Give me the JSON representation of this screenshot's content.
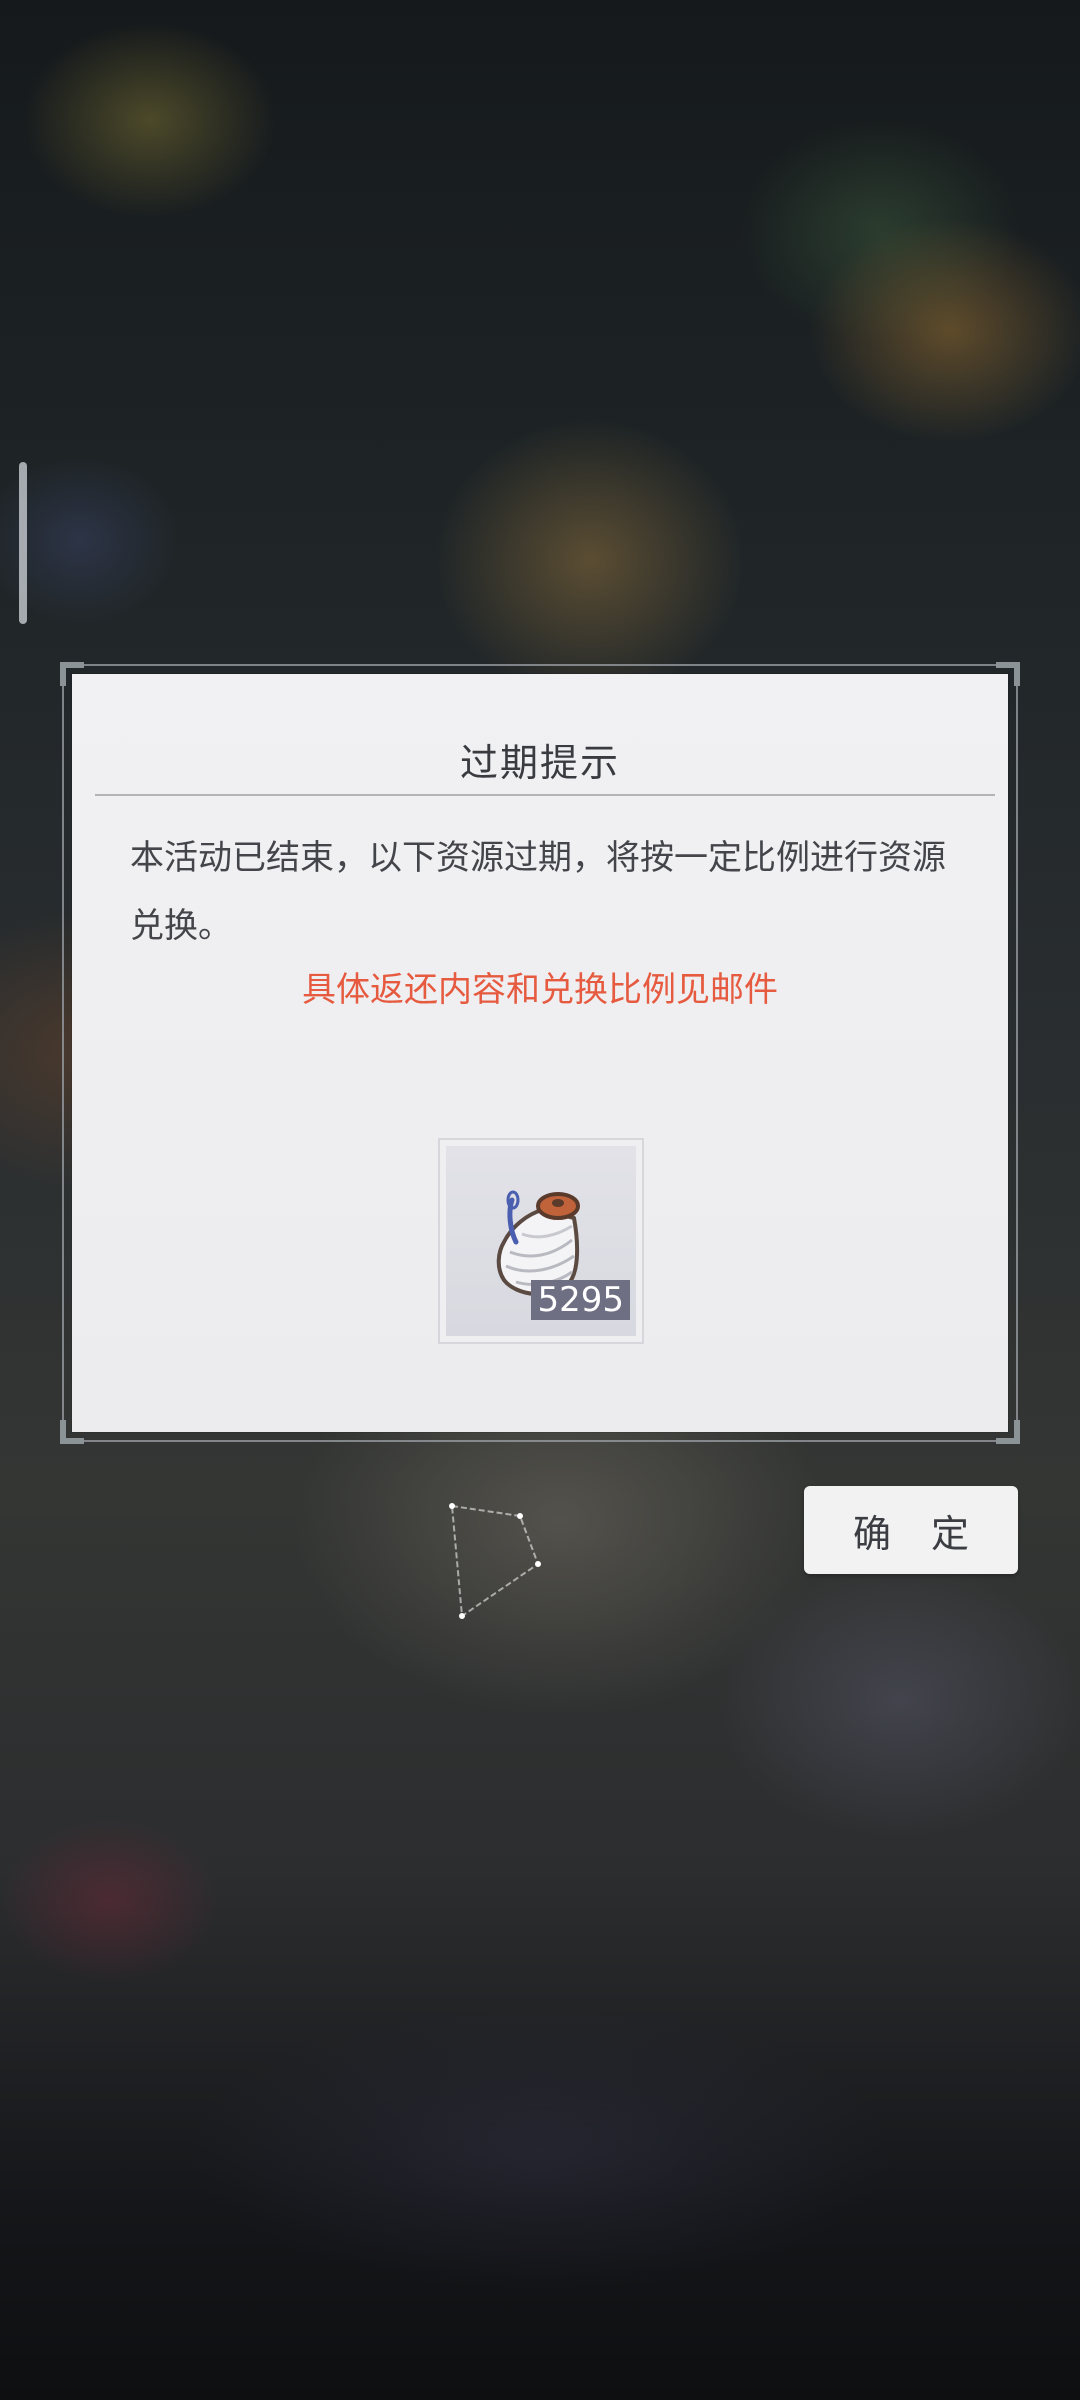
{
  "dialog": {
    "title": "过期提示",
    "message": "本活动已结束，以下资源过期，将按一定比例进行资源兑换。",
    "notice": "具体返还内容和兑换比例见邮件",
    "item": {
      "icon": "thread-spool-icon",
      "count": "5295"
    }
  },
  "confirm_button": {
    "label": "确 定"
  },
  "colors": {
    "notice": "#e65a3f",
    "dialog_bg": "#efeff1",
    "count_badge": "#6f6f84"
  }
}
